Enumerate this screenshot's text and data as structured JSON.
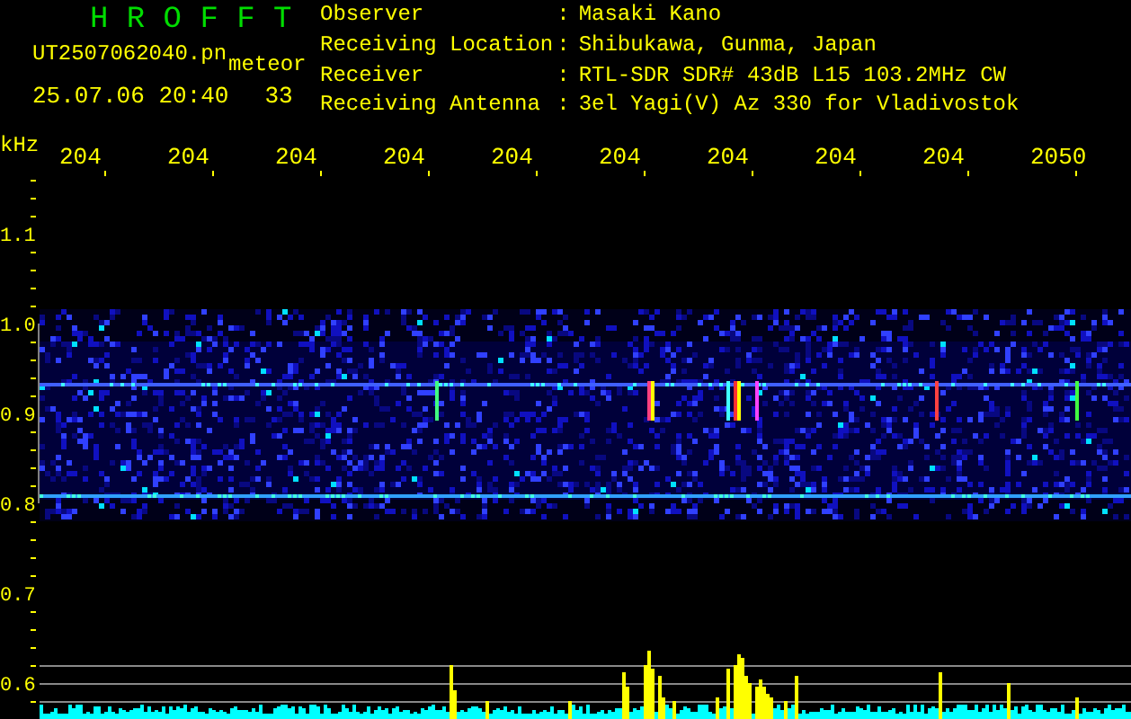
{
  "header": {
    "logo": "H R O F F T",
    "file_name": "UT2507062040.pn",
    "mode": "meteor",
    "timestamp": "25.07.06 20:40",
    "count": "33"
  },
  "station_info": [
    {
      "label": "Observer",
      "separator": ":",
      "value": "Masaki Kano"
    },
    {
      "label": "Receiving Location",
      "separator": ":",
      "value": "Shibukawa, Gunma, Japan"
    },
    {
      "label": "Receiver",
      "separator": ":",
      "value": "RTL-SDR SDR# 43dB L15 103.2MHz CW"
    },
    {
      "label": "Receiving Antenna",
      "separator": ":",
      "value": "3el Yagi(V) Az 330 for Vladivostok"
    }
  ],
  "spectrogram": {
    "y_unit": "kHz",
    "x_labels": [
      "204",
      "204",
      "204",
      "204",
      "204",
      "204",
      "204",
      "204",
      "204",
      "2050"
    ],
    "y_labels": [
      "1.1",
      "1.0",
      "0.9",
      "0.8",
      "0.7",
      "0.6"
    ]
  }
}
